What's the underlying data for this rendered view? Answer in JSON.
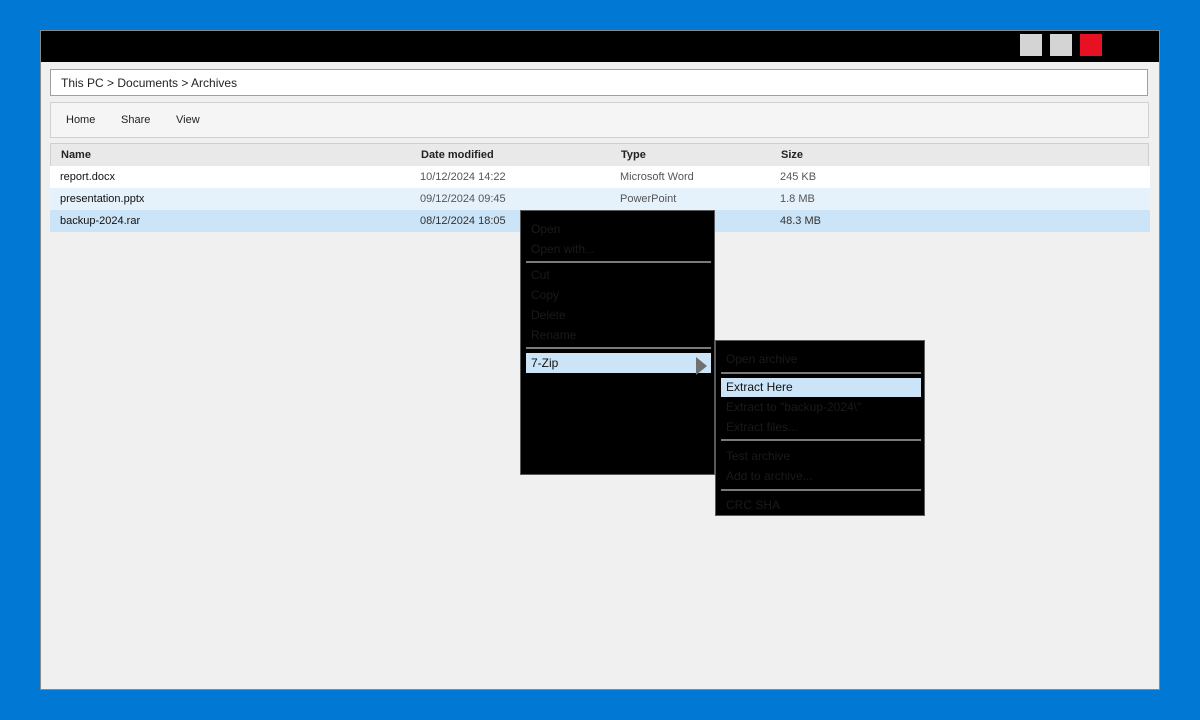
{
  "breadcrumb": "This PC > Documents > Archives",
  "ribbon": {
    "home": "Home",
    "share": "Share",
    "view": "View"
  },
  "columns": {
    "name": "Name",
    "date": "Date modified",
    "type": "Type",
    "size": "Size"
  },
  "files": [
    {
      "name": "report.docx",
      "date": "10/12/2024 14:22",
      "type": "Microsoft Word",
      "size": "245 KB"
    },
    {
      "name": "presentation.pptx",
      "date": "09/12/2024 09:45",
      "type": "PowerPoint",
      "size": "1.8 MB"
    },
    {
      "name": "backup-2024.rar",
      "date": "08/12/2024 18:05",
      "type": "",
      "size": "48.3 MB"
    }
  ],
  "context_menu": {
    "open": "Open",
    "open_with": "Open with...",
    "cut": "Cut",
    "copy": "Copy",
    "delete": "Delete",
    "rename": "Rename",
    "seven_zip": "7-Zip"
  },
  "submenu": {
    "open_archive": "Open archive",
    "extract_here": "Extract Here",
    "extract_to": "Extract to \"backup-2024\\\"",
    "extract_files": "Extract files...",
    "test_archive": "Test archive",
    "add_to_archive": "Add to archive...",
    "crc_sha": "CRC SHA"
  },
  "colors": {
    "desktop": "#0078d4",
    "titlebar": "#000000",
    "close_button": "#e81123",
    "selection": "#cce4f7",
    "menu_bg": "#000000"
  }
}
